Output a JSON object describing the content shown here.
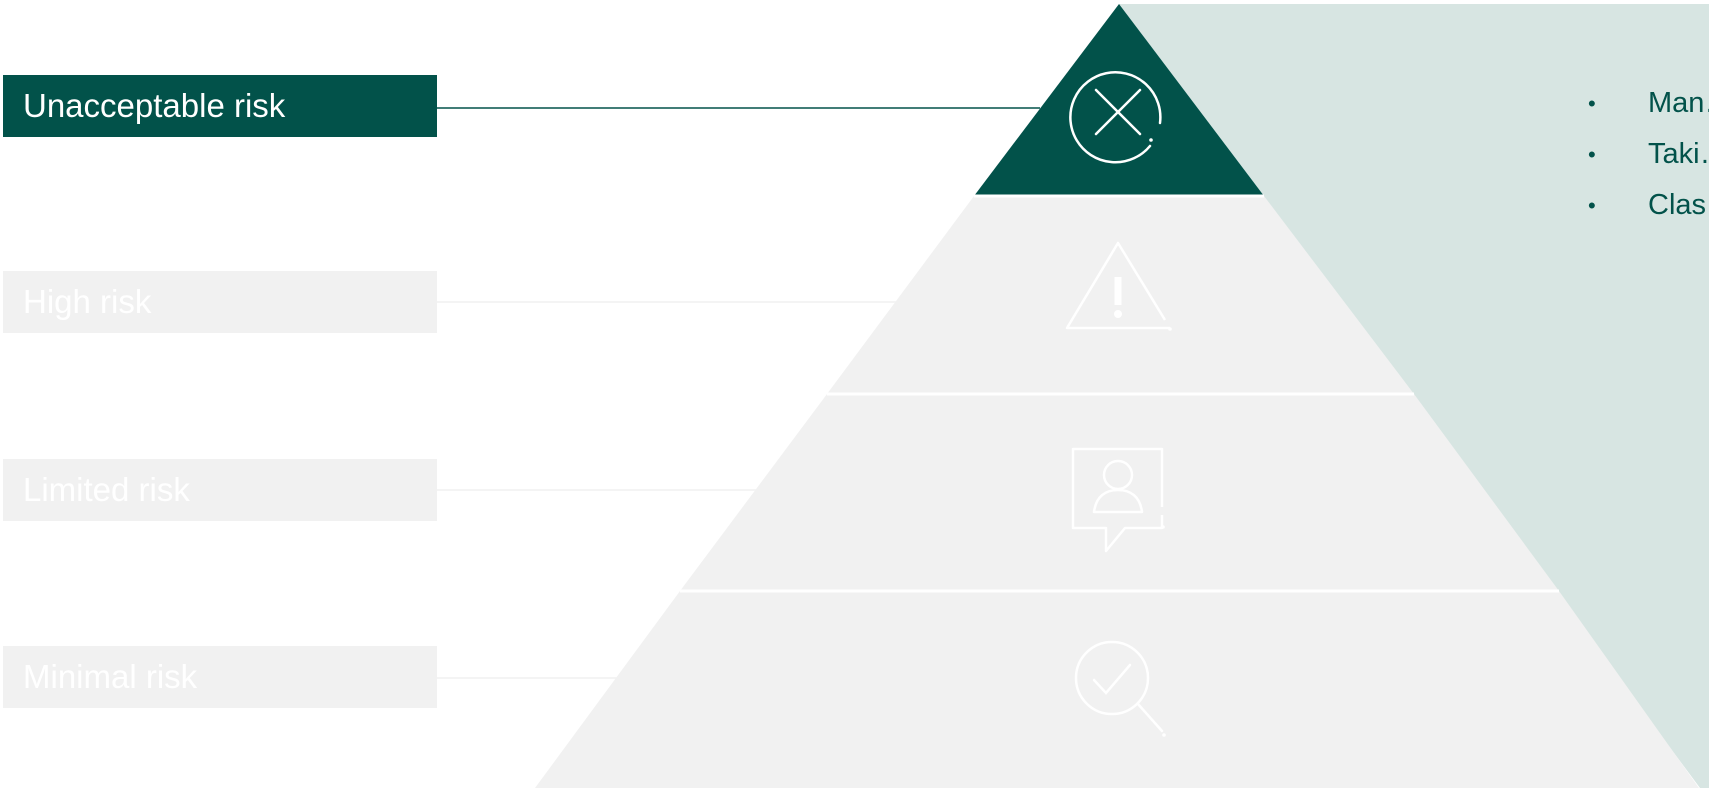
{
  "tiers": [
    {
      "label": "Unacceptable risk",
      "icon": "prohibited-icon",
      "active": true
    },
    {
      "label": "High risk",
      "icon": "warning-icon",
      "active": false
    },
    {
      "label": "Limited risk",
      "icon": "user-chat-icon",
      "active": false
    },
    {
      "label": "Minimal risk",
      "icon": "magnifier-check-icon",
      "active": false
    }
  ],
  "details": {
    "items": [
      "Man… phys…",
      "Taki… vuln…",
      "Clas… pers… scor…"
    ]
  },
  "colors": {
    "active": "#02524a",
    "inactive": "#f1f1f1",
    "panel": "#d7e5e2",
    "text_active": "#ffffff"
  }
}
